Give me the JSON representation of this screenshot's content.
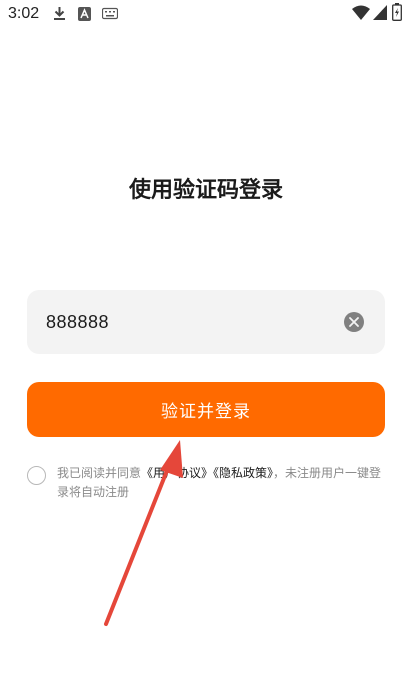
{
  "status_bar": {
    "time": "3:02",
    "icons": [
      "download-icon",
      "font-a-icon",
      "keyboard-icon",
      "wifi-icon",
      "signal-icon",
      "battery-icon"
    ]
  },
  "page": {
    "title": "使用验证码登录"
  },
  "code_field": {
    "value": "888888"
  },
  "login_button": {
    "label": "验证并登录"
  },
  "agreement": {
    "prefix": "我已阅读并同意",
    "user_agreement": "《用户协议》",
    "privacy_policy": "《隐私政策》",
    "suffix": "，未注册用户一键登录将自动注册"
  },
  "colors": {
    "accent": "#ff6a00",
    "annotation_arrow": "#e5473a"
  }
}
